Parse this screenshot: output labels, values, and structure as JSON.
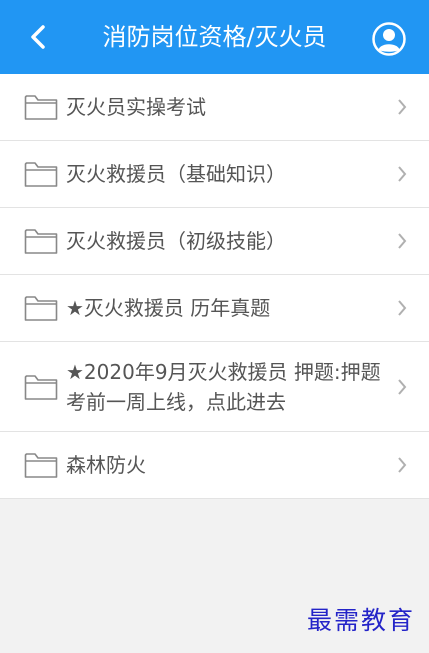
{
  "header": {
    "title": "消防岗位资格/灭火员",
    "back_icon": "chevron-left-icon",
    "user_icon": "user-avatar-icon"
  },
  "list": {
    "items": [
      {
        "label": "灭火员实操考试"
      },
      {
        "label": "灭火救援员（基础知识）"
      },
      {
        "label": "灭火救援员（初级技能）"
      },
      {
        "label": "★灭火救援员 历年真题"
      },
      {
        "label": "★2020年9月灭火救援员 押题:押题考前一周上线，点此进去"
      },
      {
        "label": "森林防火"
      }
    ],
    "folder_icon": "folder-icon",
    "chevron_icon": "chevron-right-icon"
  },
  "watermark": "最需教育",
  "colors": {
    "header": "#2196f3",
    "background": "#f2f2f2",
    "text": "#555555",
    "watermark": "#2424c8"
  }
}
